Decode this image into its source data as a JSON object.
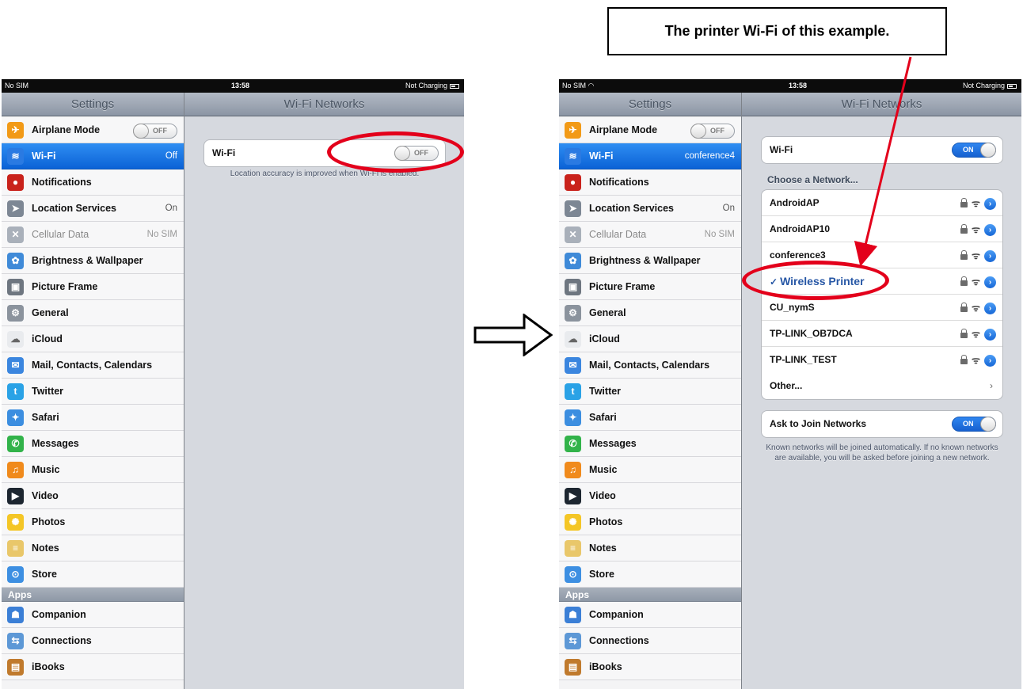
{
  "callout": {
    "text": "The printer Wi-Fi of this example."
  },
  "status_left": {
    "carrier": "No SIM",
    "time": "13:58",
    "charging": "Not Charging"
  },
  "status_right": {
    "carrier": "No SIM",
    "time": "13:58",
    "charging": "Not Charging"
  },
  "left_panel": {
    "sidebar_title": "Settings",
    "detail_title": "Wi-Fi Networks",
    "wifi_label": "Wi-Fi",
    "wifi_switch": "OFF",
    "note": "Location accuracy is improved when Wi-Fi is enabled.",
    "items": [
      {
        "label": "Airplane Mode",
        "switch": "OFF"
      },
      {
        "label": "Wi-Fi",
        "value": "Off"
      },
      {
        "label": "Notifications"
      },
      {
        "label": "Location Services",
        "value": "On"
      },
      {
        "label": "Cellular Data",
        "value": "No SIM"
      },
      {
        "label": "Brightness & Wallpaper"
      },
      {
        "label": "Picture Frame"
      },
      {
        "label": "General"
      },
      {
        "label": "iCloud"
      },
      {
        "label": "Mail, Contacts, Calendars"
      },
      {
        "label": "Twitter"
      },
      {
        "label": "Safari"
      },
      {
        "label": "Messages"
      },
      {
        "label": "Music"
      },
      {
        "label": "Video"
      },
      {
        "label": "Photos"
      },
      {
        "label": "Notes"
      },
      {
        "label": "Store"
      }
    ],
    "apps_header": "Apps",
    "apps": [
      {
        "label": "Companion"
      },
      {
        "label": "Connections"
      },
      {
        "label": "iBooks"
      }
    ]
  },
  "right_panel": {
    "sidebar_title": "Settings",
    "detail_title": "Wi-Fi Networks",
    "wifi_label": "Wi-Fi",
    "wifi_switch": "ON",
    "choose_header": "Choose a Network...",
    "networks": [
      {
        "name": "AndroidAP"
      },
      {
        "name": "AndroidAP10"
      },
      {
        "name": "conference3"
      },
      {
        "name": "Wireless Printer",
        "check": "✓"
      },
      {
        "name": "CU_nymS"
      },
      {
        "name": "TP-LINK_OB7DCA"
      },
      {
        "name": "TP-LINK_TEST"
      }
    ],
    "other_label": "Other...",
    "ask_label": "Ask to Join Networks",
    "ask_switch": "ON",
    "ask_note": "Known networks will be joined automatically. If no known networks are available, you will be asked before joining a new network.",
    "items": [
      {
        "label": "Airplane Mode",
        "switch": "OFF"
      },
      {
        "label": "Wi-Fi",
        "value": "conference4"
      },
      {
        "label": "Notifications"
      },
      {
        "label": "Location Services",
        "value": "On"
      },
      {
        "label": "Cellular Data",
        "value": "No SIM"
      },
      {
        "label": "Brightness & Wallpaper"
      },
      {
        "label": "Picture Frame"
      },
      {
        "label": "General"
      },
      {
        "label": "iCloud"
      },
      {
        "label": "Mail, Contacts, Calendars"
      },
      {
        "label": "Twitter"
      },
      {
        "label": "Safari"
      },
      {
        "label": "Messages"
      },
      {
        "label": "Music"
      },
      {
        "label": "Video"
      },
      {
        "label": "Photos"
      },
      {
        "label": "Notes"
      },
      {
        "label": "Store"
      }
    ],
    "apps_header": "Apps",
    "apps": [
      {
        "label": "Companion"
      },
      {
        "label": "Connections"
      },
      {
        "label": "iBooks"
      }
    ]
  },
  "icons": {
    "sidebar_items": [
      "airplane-icon",
      "wifi-icon",
      "notifications-icon",
      "location-icon",
      "cellular-icon",
      "brightness-icon",
      "picture-frame-icon",
      "gear-icon",
      "icloud-icon",
      "mail-icon",
      "twitter-icon",
      "safari-icon",
      "messages-icon",
      "music-icon",
      "video-icon",
      "photos-icon",
      "notes-icon",
      "store-icon"
    ],
    "apps": [
      "companion-icon",
      "connections-icon",
      "ibooks-icon"
    ]
  },
  "colors": {
    "selection_blue": "#1a73e8",
    "annotation_red": "#e3001b",
    "switch_on": "#1f6fd8"
  }
}
